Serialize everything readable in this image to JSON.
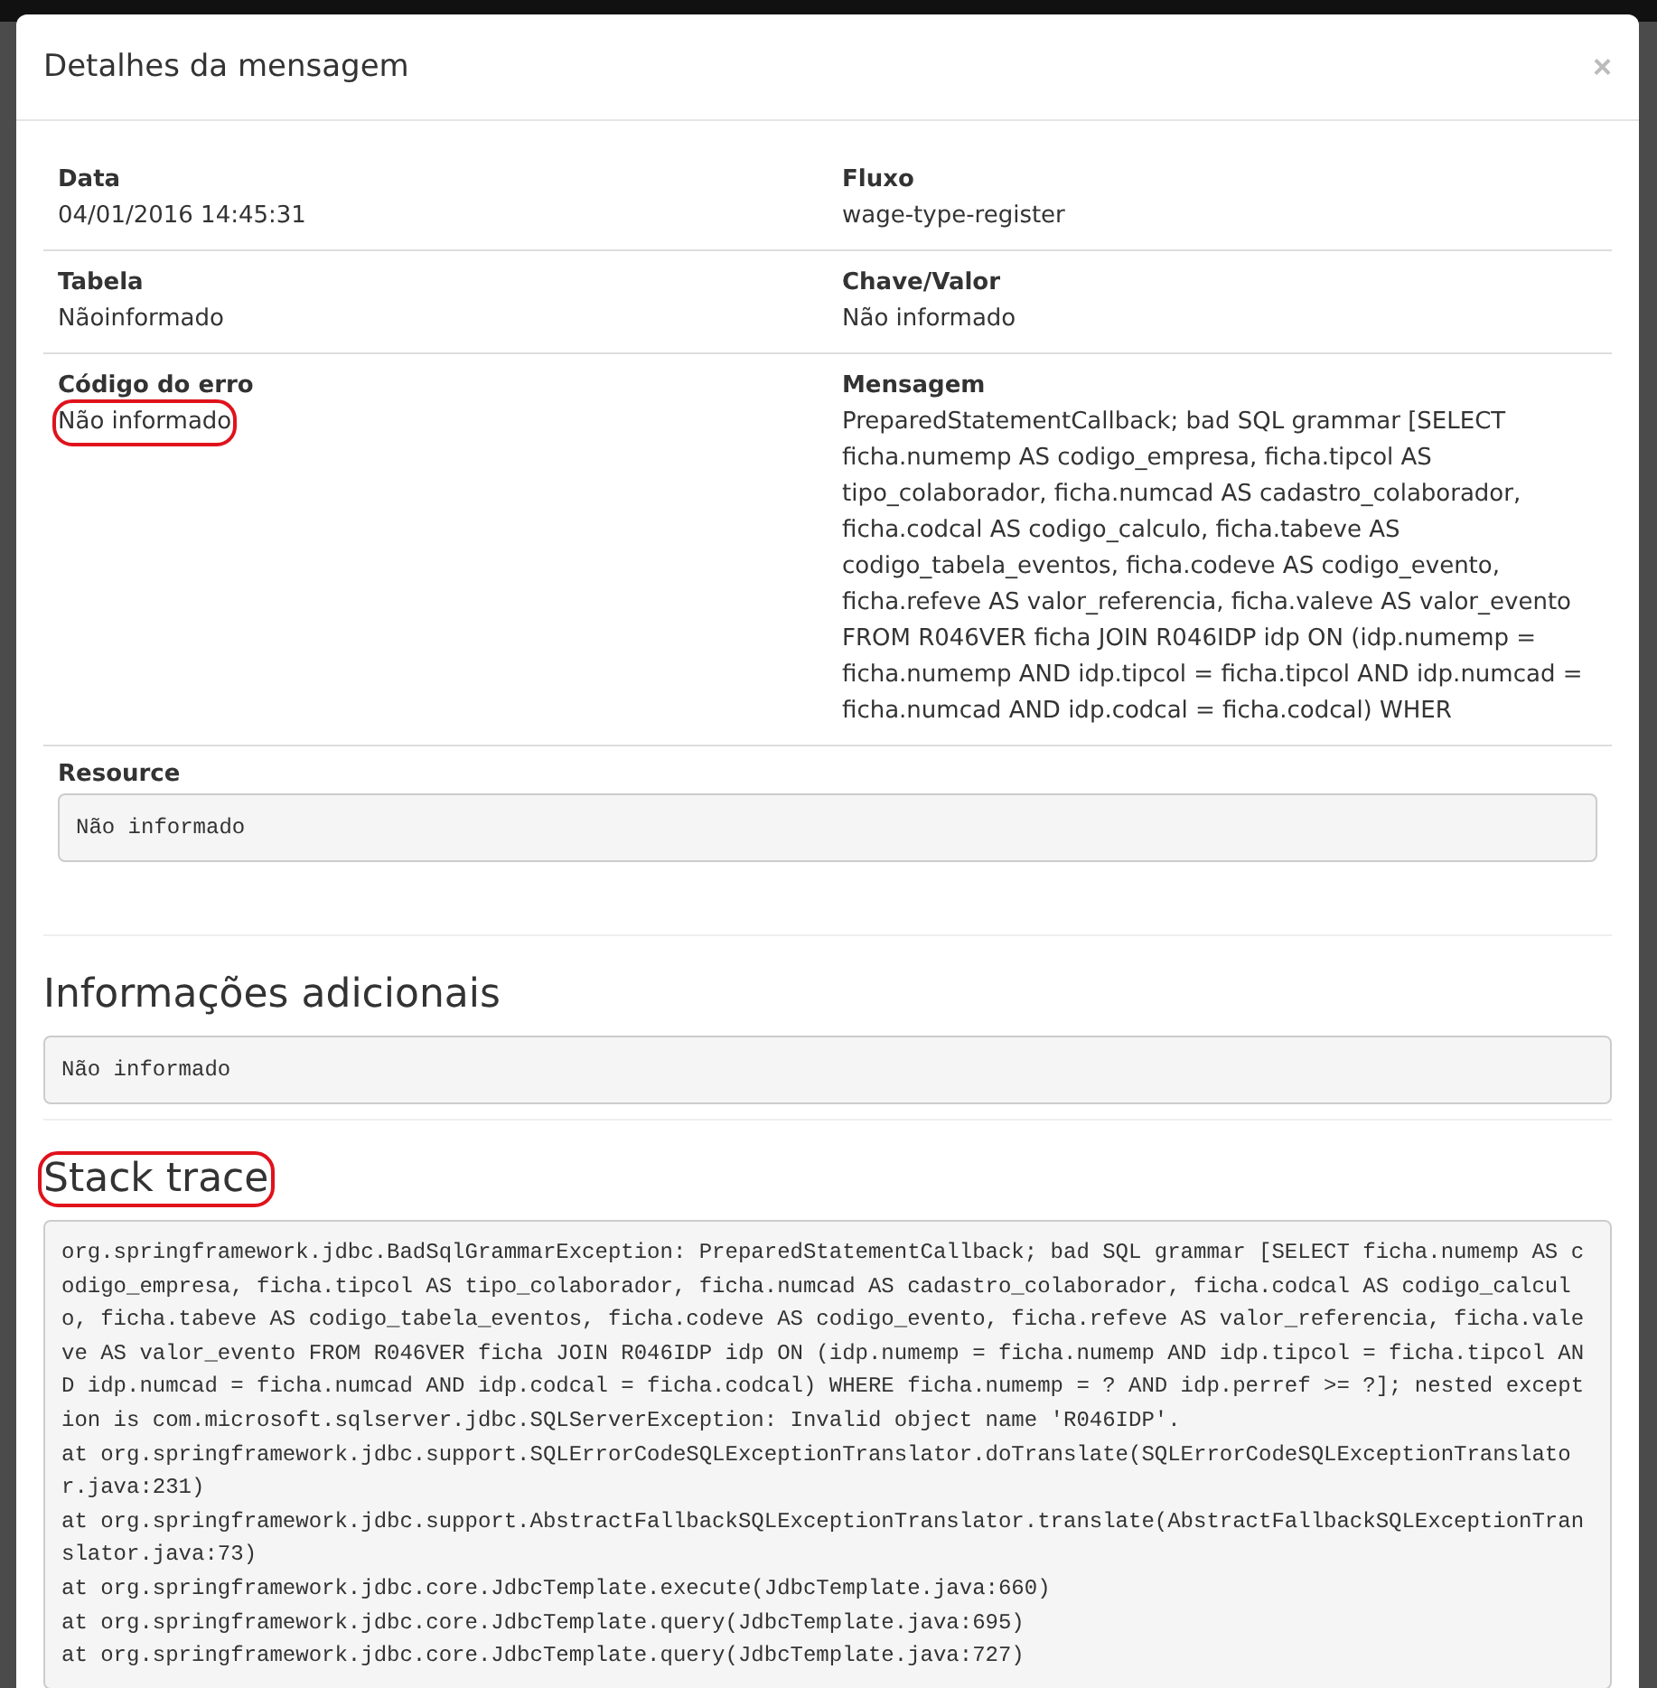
{
  "modal": {
    "title": "Detalhes da mensagem",
    "close": "×",
    "fields": [
      {
        "label": "Data",
        "value": "04/01/2016 14:45:31",
        "highlighted": false
      },
      {
        "label": "Fluxo",
        "value": "wage-type-register",
        "highlighted": false
      },
      {
        "label": "Tabela",
        "value": "Nãoinformado",
        "highlighted": false
      },
      {
        "label": "Chave/Valor",
        "value": "Não informado",
        "highlighted": false
      },
      {
        "label": "Código do erro",
        "value": "Não informado",
        "highlighted": true
      },
      {
        "label": "Mensagem",
        "value": "PreparedStatementCallback; bad SQL grammar [SELECT ficha.numemp AS codigo_empresa, ficha.tipcol AS tipo_colaborador, ficha.numcad AS cadastro_colaborador, ficha.codcal AS codigo_calculo, ficha.tabeve AS codigo_tabela_eventos, ficha.codeve AS codigo_evento, ficha.refeve AS valor_referencia, ficha.valeve AS valor_evento FROM R046VER ficha JOIN R046IDP idp ON (idp.numemp = ficha.numemp AND idp.tipcol = ficha.tipcol AND idp.numcad = ficha.numcad AND idp.codcal = ficha.codcal) WHER",
        "highlighted": false
      }
    ],
    "resource": {
      "label": "Resource",
      "value": "Não informado"
    },
    "additional": {
      "title": "Informações adicionais",
      "value": "Não informado",
      "highlighted": false
    },
    "stack": {
      "title": "Stack trace",
      "highlighted": true,
      "lines": [
        "org.springframework.jdbc.BadSqlGrammarException: PreparedStatementCallback; bad SQL grammar [SELECT ficha.numemp AS codigo_empresa, ficha.tipcol AS tipo_colaborador, ficha.numcad AS cadastro_colaborador, ficha.codcal AS codigo_calculo, ficha.tabeve AS codigo_tabela_eventos, ficha.codeve AS codigo_evento, ficha.refeve AS valor_referencia, ficha.valeve AS valor_evento FROM R046VER ficha JOIN R046IDP idp ON (idp.numemp = ficha.numemp AND idp.tipcol = ficha.tipcol AND idp.numcad = ficha.numcad AND idp.codcal = ficha.codcal) WHERE ficha.numemp = ? AND idp.perref >= ?]; nested exception is com.microsoft.sqlserver.jdbc.SQLServerException: Invalid object name 'R046IDP'.",
        "at org.springframework.jdbc.support.SQLErrorCodeSQLExceptionTranslator.doTranslate(SQLErrorCodeSQLExceptionTranslator.java:231)",
        "at org.springframework.jdbc.support.AbstractFallbackSQLExceptionTranslator.translate(AbstractFallbackSQLExceptionTranslator.java:73)",
        "at org.springframework.jdbc.core.JdbcTemplate.execute(JdbcTemplate.java:660)",
        "at org.springframework.jdbc.core.JdbcTemplate.query(JdbcTemplate.java:695)",
        "at org.springframework.jdbc.core.JdbcTemplate.query(JdbcTemplate.java:727)"
      ]
    }
  }
}
